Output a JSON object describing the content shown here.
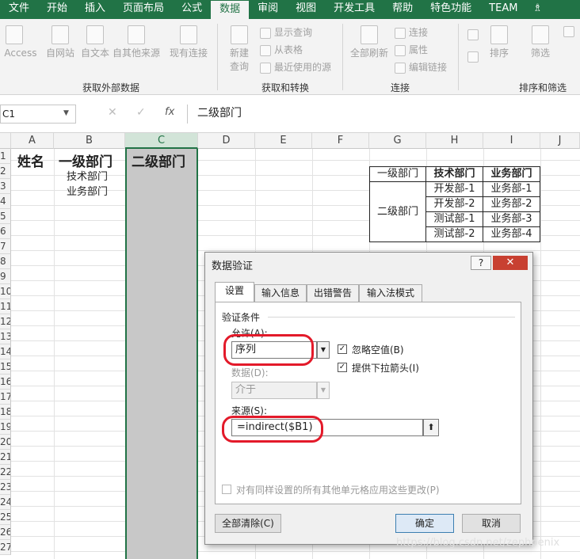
{
  "ribbon_tabs": [
    "文件",
    "开始",
    "插入",
    "页面布局",
    "公式",
    "数据",
    "审阅",
    "视图",
    "开发工具",
    "帮助",
    "特色功能",
    "TEAM"
  ],
  "active_tab": "数据",
  "help_icon": "lightbulb-icon",
  "ribbon": {
    "external": {
      "label": "获取外部数据",
      "buttons": [
        "自 Access",
        "自网站",
        "自文本",
        "自其他来源",
        "现有连接"
      ]
    },
    "transform": {
      "label": "获取和转换",
      "new_query": [
        "新建",
        "查询"
      ],
      "small": [
        "显示查询",
        "从表格",
        "最近使用的源"
      ]
    },
    "connections": {
      "label": "连接",
      "refresh_all": "全部刷新",
      "small": [
        "连接",
        "属性",
        "编辑链接"
      ]
    },
    "sort_filter": {
      "label": "排序和筛选",
      "sort": "排序",
      "filter": "筛选"
    }
  },
  "formula_bar": {
    "name_box": "C1",
    "fx": "fx",
    "formula": "二级部门"
  },
  "grid": {
    "columns": [
      "A",
      "B",
      "C",
      "D",
      "E",
      "F",
      "G",
      "H",
      "I",
      "J"
    ],
    "rows": [
      "1",
      "2",
      "3",
      "4",
      "5",
      "6",
      "7",
      "8",
      "9",
      "10",
      "11",
      "12",
      "13",
      "14",
      "15",
      "16",
      "17",
      "18",
      "19",
      "20",
      "21",
      "22",
      "23",
      "24",
      "25",
      "26",
      "27"
    ],
    "selected_column": "C",
    "a1": "姓名",
    "b1": "一级部门",
    "c1": "二级部门",
    "b2": "技术部门",
    "b3": "业务部门"
  },
  "mini_table": {
    "g_top": "一级部门",
    "g_bottom": "二级部门",
    "headers": [
      "技术部门",
      "业务部门"
    ],
    "tech": [
      "开发部-1",
      "开发部-2",
      "测试部-1",
      "测试部-2"
    ],
    "biz": [
      "业务部-1",
      "业务部-2",
      "业务部-3",
      "业务部-4"
    ]
  },
  "dialog": {
    "title": "数据验证",
    "help": "?",
    "close": "✕",
    "tabs": [
      "设置",
      "输入信息",
      "出错警告",
      "输入法模式"
    ],
    "active_tab": "设置",
    "section": "验证条件",
    "allow_label": "允许(A):",
    "allow_value": "序列",
    "ignore_blank": "忽略空值(B)",
    "dropdown_arrow": "提供下拉箭头(I)",
    "data_label": "数据(D):",
    "data_value": "介于",
    "source_label": "来源(S):",
    "source_value": "=indirect($B1)",
    "apply_all": "对有同样设置的所有其他单元格应用这些更改(P)",
    "clear_all": "全部清除(C)",
    "ok": "确定",
    "cancel": "取消"
  },
  "watermark": "https://blog.csdn.net/zephpenix",
  "colors": {
    "excel_green": "#217346",
    "highlight_red": "#e31a2a",
    "selected_column_fill": "#c8c8c8"
  }
}
